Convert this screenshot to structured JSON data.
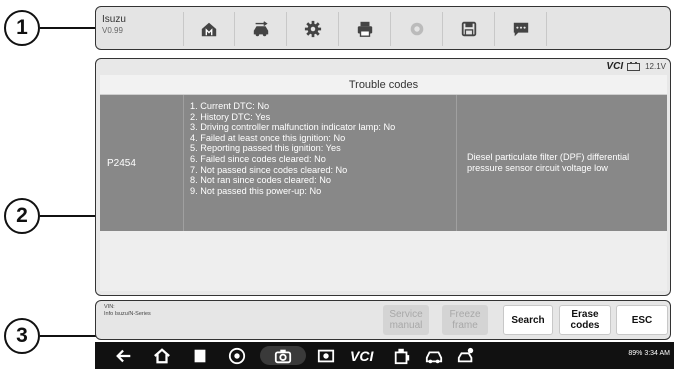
{
  "callouts": [
    "1",
    "2",
    "3"
  ],
  "toolbar": {
    "vehicle": "Isuzu",
    "version": "V0.99",
    "icons": [
      "home-icon",
      "vehicle-swap-icon",
      "settings-icon",
      "print-icon",
      "help-icon",
      "save-icon",
      "feedback-icon"
    ]
  },
  "main": {
    "vci_label": "VCI",
    "voltage": "12.1V",
    "table_title": "Trouble codes",
    "rows": [
      {
        "code": "P2454",
        "status": [
          "1. Current DTC: No",
          "2. History DTC: Yes",
          "3. Driving controller malfunction indicator lamp: No",
          "4. Failed at least once this ignition: No",
          "5. Reporting passed this ignition: Yes",
          "6. Failed since codes cleared: No",
          "7. Not passed since codes cleared: No",
          "8. Not ran since codes cleared: No",
          "9. Not passed this power-up: No"
        ],
        "description": "Diesel particulate filter (DPF) differential pressure sensor circuit voltage low"
      }
    ]
  },
  "bottom": {
    "vin_label": "VIN:",
    "info": "Info Isuzu/N-Series",
    "buttons": {
      "service_manual": "Service manual",
      "freeze_frame": "Freeze frame",
      "search": "Search",
      "erase_codes": "Erase codes",
      "esc": "ESC"
    }
  },
  "navbar": {
    "vcs": "VCI",
    "status": "89% 3:34 AM"
  },
  "colors": {
    "row_highlight": "#888888",
    "toolbar_bg": "#e4e4e4",
    "nav_bg": "#111111"
  }
}
